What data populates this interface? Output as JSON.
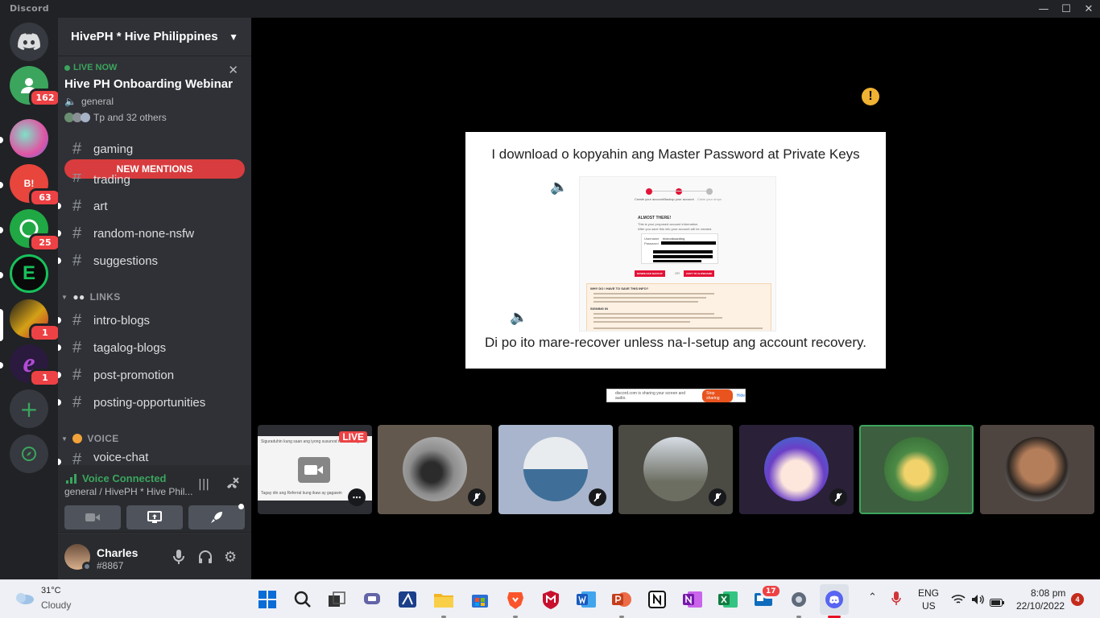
{
  "window": {
    "app_name": "Discord"
  },
  "servers": {
    "badges": [
      "162",
      "63",
      "25",
      "1",
      "1"
    ]
  },
  "guild": {
    "name": "HivePH * Hive Philippines"
  },
  "live_event": {
    "status": "LIVE NOW",
    "title": "Hive PH Onboarding Webinar",
    "channel": "general",
    "attendees": "Tp and 32 others"
  },
  "channels_top": [
    {
      "name": "gaming"
    },
    {
      "name": "trading"
    },
    {
      "name": "art"
    },
    {
      "name": "random-none-nsfw"
    },
    {
      "name": "suggestions"
    }
  ],
  "new_mentions": "NEW MENTIONS",
  "categories": {
    "links": "LINKS",
    "voice": "VOICE"
  },
  "channels_links": [
    {
      "name": "intro-blogs"
    },
    {
      "name": "tagalog-blogs"
    },
    {
      "name": "post-promotion"
    },
    {
      "name": "posting-opportunities"
    }
  ],
  "voice_channel": "voice-chat",
  "voice": {
    "status": "Voice Connected",
    "location": "general / HivePH * Hive Phil..."
  },
  "user": {
    "name": "Charles",
    "tag": "#8867"
  },
  "stream": {
    "slide_title": "I download o kopyahin ang Master Password at Private Keys",
    "slide_subtitle": "Di po ito mare-recover unless na-I-setup ang account recovery.",
    "share_text": "discord.com is sharing your screen and audio.",
    "share_stop": "Stop sharing",
    "share_hide": "Hide",
    "live_badge": "LIVE",
    "preview_caption_top": "Siguraduhin kung saan ang iyong susunod na hakbang",
    "preview_caption_bottom": "Tagay din ang Referral kung ikaw ay gagawin"
  },
  "screenshot_in_slide": {
    "steps": [
      "Create your account",
      "Backup your account",
      "Claim your drops"
    ],
    "heading": "ALMOST THERE!",
    "line1": "This is your proposed account information.",
    "line2": "After you save this info your account will be created.",
    "user_label": "Username",
    "user_value": "hiveonboarding",
    "pass_label": "Password",
    "btn_download": "DOWNLOAD BACKUP",
    "or": "OR",
    "btn_copy": "COPY TO CLIPBOARD",
    "why_title": "WHY DO I HAVE TO SAVE THIS INFO?",
    "signing_title": "SIGNING IN"
  },
  "taskbar": {
    "weather_temp": "31°C",
    "weather_desc": "Cloudy",
    "lang": "ENG",
    "region": "US",
    "time": "8:08 pm",
    "date": "22/10/2022",
    "notif_count": "4",
    "store_badge": "17"
  },
  "colors": {
    "discord_blurple": "#5865f2",
    "online_green": "#3ba55d",
    "mention_red": "#ed4245",
    "speaking_border": "#3ba55d"
  }
}
